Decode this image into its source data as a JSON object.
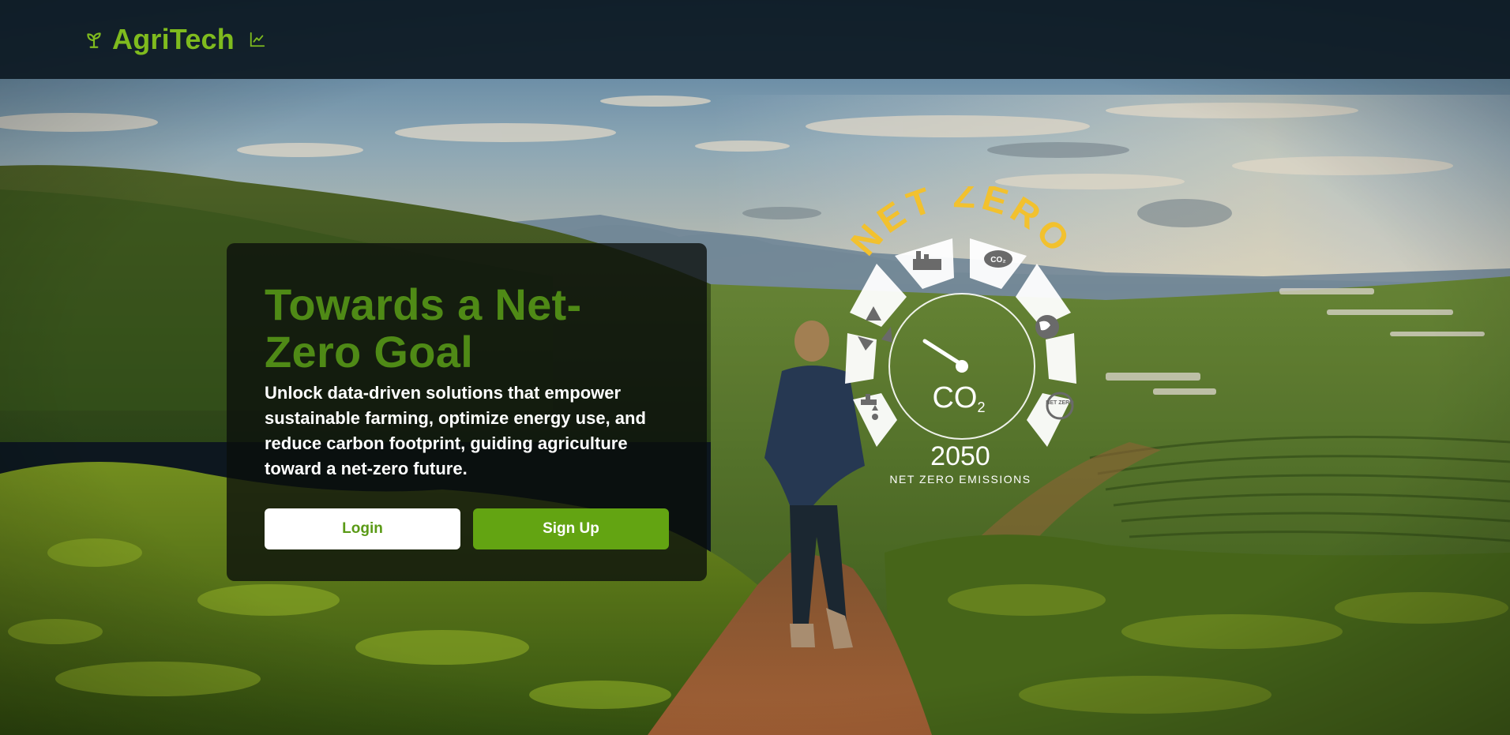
{
  "header": {
    "brand_name": "AgriTech",
    "brand_icon": "sprout-icon",
    "trend_icon": "line-chart-icon"
  },
  "hero": {
    "title": "Towards a Net-Zero Goal",
    "description": "Unlock data-driven solutions that empower sustainable farming, optimize energy use, and reduce carbon footprint, guiding agriculture toward a net-zero future.",
    "login_label": "Login",
    "signup_label": "Sign Up"
  },
  "badge": {
    "arc_text": "NET ZERO",
    "co2_text": "CO",
    "co2_subscript": "2",
    "cloud_text": "CO₂",
    "netzero_small": "NET ZERO",
    "year": "2050",
    "caption": "NET ZERO EMISSIONS",
    "segment_icons": [
      "factory-icon",
      "cloud-co2-icon",
      "globe-icon",
      "net-zero-icon",
      "water-tap-icon",
      "recycle-icon"
    ]
  },
  "colors": {
    "brand_green": "#7fbb1e",
    "title_green": "#4f8a16",
    "button_green": "#63a412",
    "badge_yellow": "#f2c12e",
    "header_bg": "#0e1b24"
  }
}
